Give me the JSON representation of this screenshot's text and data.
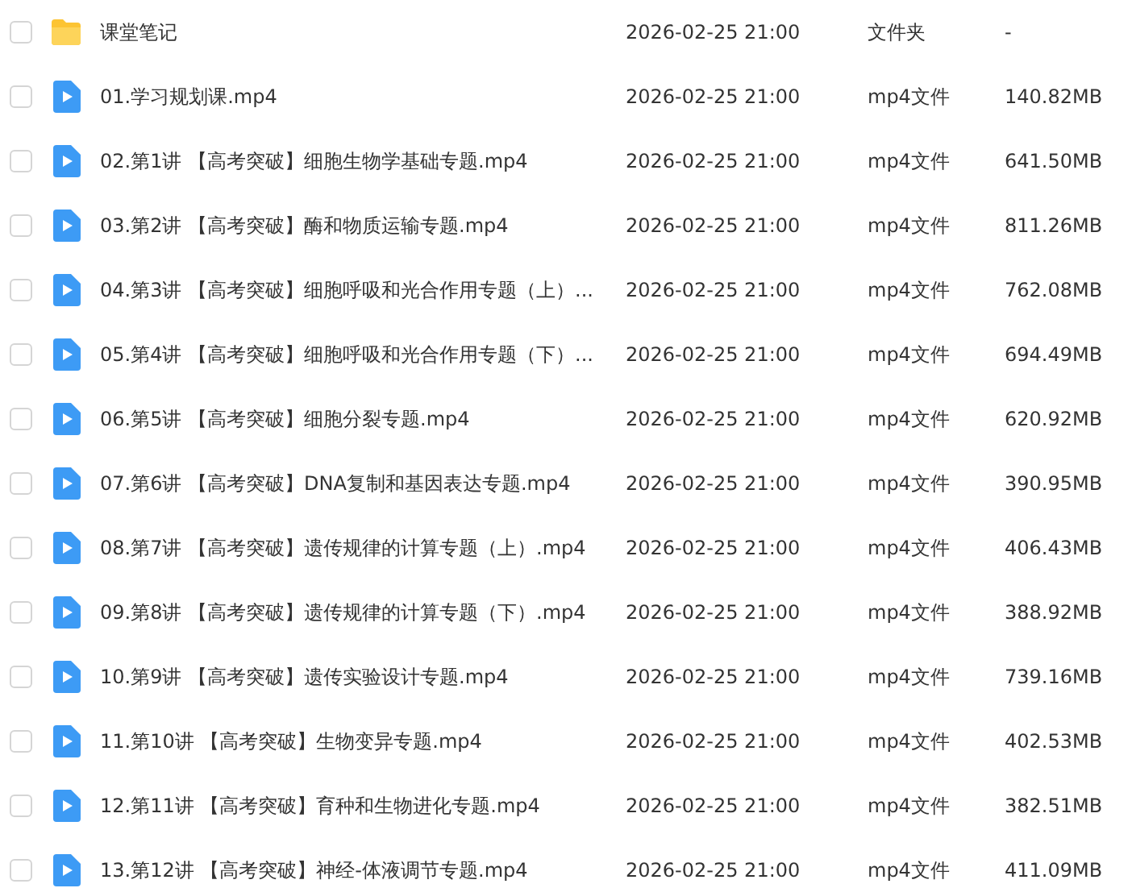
{
  "files": [
    {
      "kind": "folder",
      "checked": false,
      "name": "课堂笔记",
      "modified": "2026-02-25 21:00",
      "type": "文件夹",
      "size": "-"
    },
    {
      "kind": "video",
      "checked": false,
      "name": "01.学习规划课.mp4",
      "modified": "2026-02-25 21:00",
      "type": "mp4文件",
      "size": "140.82MB"
    },
    {
      "kind": "video",
      "checked": false,
      "name": "02.第1讲 【高考突破】细胞生物学基础专题.mp4",
      "modified": "2026-02-25 21:00",
      "type": "mp4文件",
      "size": "641.50MB"
    },
    {
      "kind": "video",
      "checked": false,
      "name": "03.第2讲 【高考突破】酶和物质运输专题.mp4",
      "modified": "2026-02-25 21:00",
      "type": "mp4文件",
      "size": "811.26MB"
    },
    {
      "kind": "video",
      "checked": false,
      "name": "04.第3讲 【高考突破】细胞呼吸和光合作用专题（上）...",
      "modified": "2026-02-25 21:00",
      "type": "mp4文件",
      "size": "762.08MB"
    },
    {
      "kind": "video",
      "checked": false,
      "name": "05.第4讲 【高考突破】细胞呼吸和光合作用专题（下）...",
      "modified": "2026-02-25 21:00",
      "type": "mp4文件",
      "size": "694.49MB"
    },
    {
      "kind": "video",
      "checked": false,
      "name": "06.第5讲 【高考突破】细胞分裂专题.mp4",
      "modified": "2026-02-25 21:00",
      "type": "mp4文件",
      "size": "620.92MB"
    },
    {
      "kind": "video",
      "checked": false,
      "name": "07.第6讲 【高考突破】DNA复制和基因表达专题.mp4",
      "modified": "2026-02-25 21:00",
      "type": "mp4文件",
      "size": "390.95MB"
    },
    {
      "kind": "video",
      "checked": false,
      "name": "08.第7讲 【高考突破】遗传规律的计算专题（上）.mp4",
      "modified": "2026-02-25 21:00",
      "type": "mp4文件",
      "size": "406.43MB"
    },
    {
      "kind": "video",
      "checked": false,
      "name": "09.第8讲 【高考突破】遗传规律的计算专题（下）.mp4",
      "modified": "2026-02-25 21:00",
      "type": "mp4文件",
      "size": "388.92MB"
    },
    {
      "kind": "video",
      "checked": false,
      "name": "10.第9讲 【高考突破】遗传实验设计专题.mp4",
      "modified": "2026-02-25 21:00",
      "type": "mp4文件",
      "size": "739.16MB"
    },
    {
      "kind": "video",
      "checked": false,
      "name": "11.第10讲 【高考突破】生物变异专题.mp4",
      "modified": "2026-02-25 21:00",
      "type": "mp4文件",
      "size": "402.53MB"
    },
    {
      "kind": "video",
      "checked": false,
      "name": "12.第11讲 【高考突破】育种和生物进化专题.mp4",
      "modified": "2026-02-25 21:00",
      "type": "mp4文件",
      "size": "382.51MB"
    },
    {
      "kind": "video",
      "checked": false,
      "name": "13.第12讲 【高考突破】神经-体液调节专题.mp4",
      "modified": "2026-02-25 21:00",
      "type": "mp4文件",
      "size": "411.09MB"
    }
  ]
}
